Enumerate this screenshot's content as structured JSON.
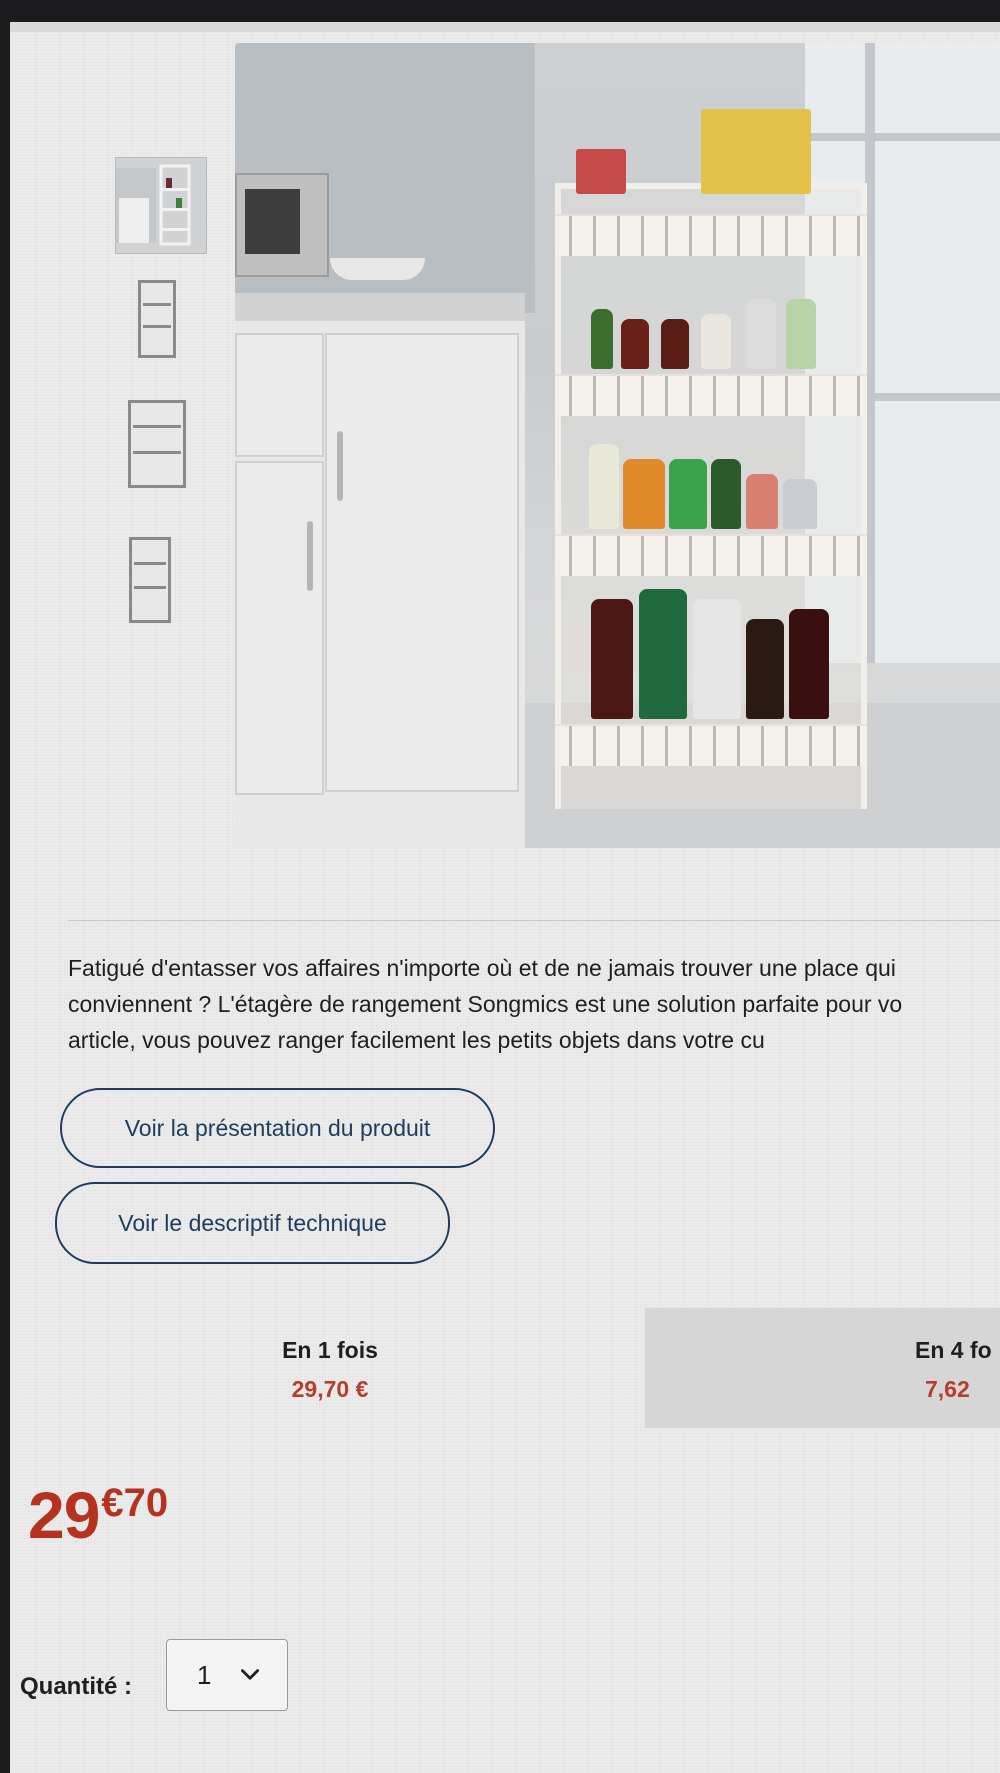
{
  "gallery": {
    "thumbnails": [
      {
        "name": "kitchen-scene",
        "active": true
      },
      {
        "name": "shelf-front-view",
        "active": false
      },
      {
        "name": "shelf-side-view",
        "active": false
      },
      {
        "name": "shelf-dimension-view",
        "active": false
      }
    ]
  },
  "product": {
    "description_lines": [
      "Fatigué d'entasser vos affaires n'importe où et de ne jamais trouver une place qui",
      "conviennent ? L'étagère de rangement Songmics est une solution parfaite pour vo",
      "article, vous pouvez ranger facilement les petits objets dans votre cu"
    ],
    "buttons": {
      "presentation": "Voir la présentation du produit",
      "technical": "Voir le descriptif technique"
    }
  },
  "payment_options": [
    {
      "title": "En 1 fois",
      "price": "29,70 €",
      "selected": false
    },
    {
      "title": "En 4 fo",
      "price": "7,62",
      "selected": true
    }
  ],
  "price": {
    "euros": "29",
    "cents": "€70"
  },
  "quantity": {
    "label": "Quantité :",
    "value": "1"
  },
  "colors": {
    "price_red": "#b5321f",
    "outline_blue": "#1e3c5c"
  }
}
